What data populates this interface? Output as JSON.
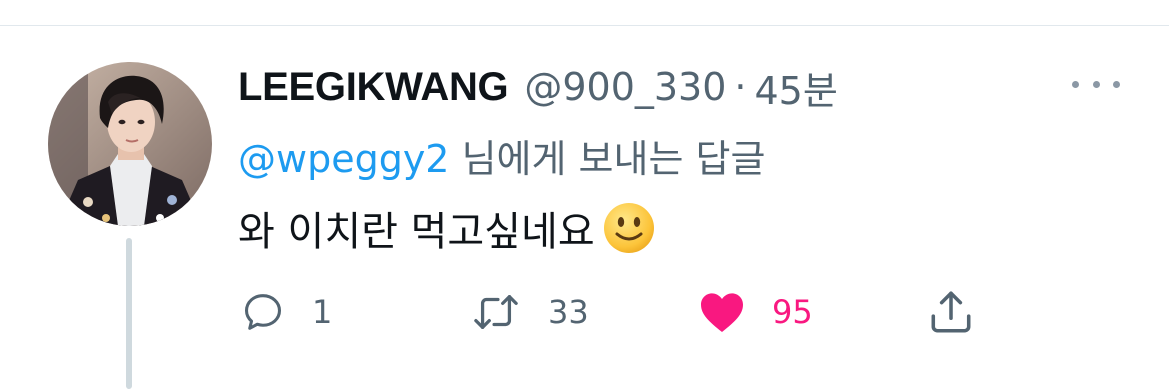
{
  "tweet": {
    "display_name": "LEEGIKWANG",
    "handle": "@900_330",
    "separator": "·",
    "time": "45분",
    "reply_to_handle": "@wpeggy2",
    "reply_to_suffix": " 님에게 보내는 답글",
    "text": "와 이치란 먹고싶네요",
    "emoji": "slightly-smiling-face"
  },
  "actions": {
    "reply_count": "1",
    "retweet_count": "33",
    "like_count": "95",
    "liked": true
  },
  "colors": {
    "link": "#1d9bf0",
    "like": "#f91880",
    "secondary_text": "#536471",
    "primary_text": "#0f1419"
  }
}
